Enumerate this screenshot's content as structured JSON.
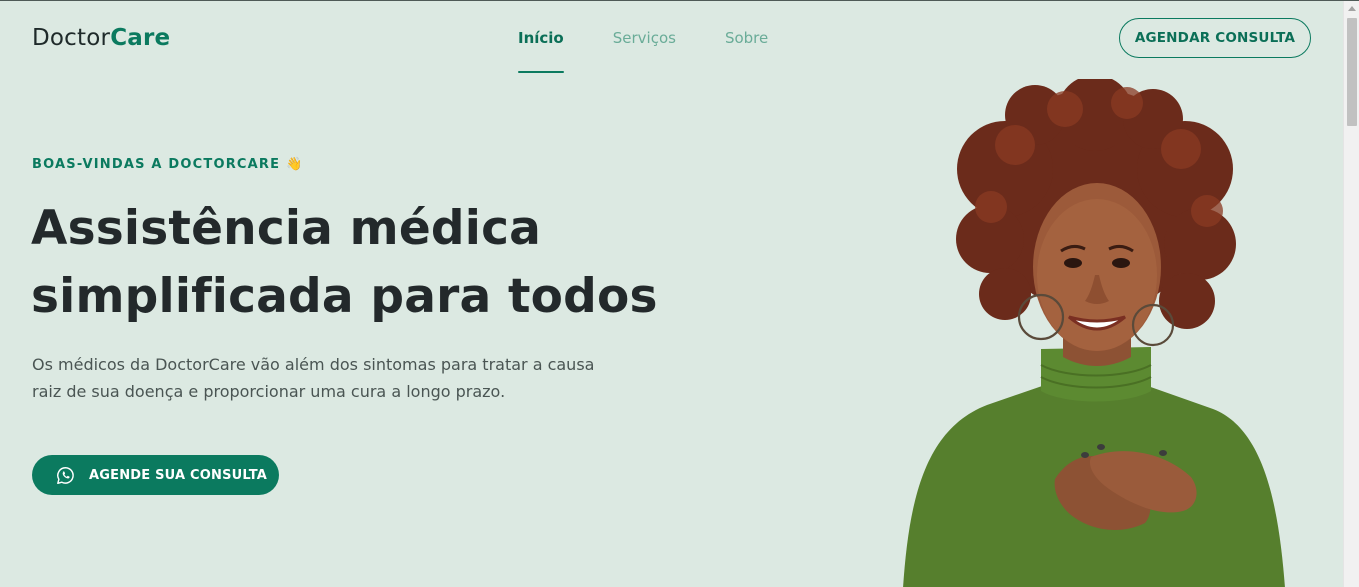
{
  "header": {
    "logo_part1": "Doctor",
    "logo_part2": "Care",
    "nav": [
      {
        "label": "Início",
        "active": true
      },
      {
        "label": "Serviços",
        "active": false
      },
      {
        "label": "Sobre",
        "active": false
      }
    ],
    "cta_label": "AGENDAR CONSULTA"
  },
  "hero": {
    "eyebrow": "BOAS-VINDAS A DOCTORCARE",
    "eyebrow_emoji": "👋",
    "title_line1": "Assistência médica",
    "title_line2": "simplificada para todos",
    "description_line1": "Os médicos da DoctorCare vão além dos sintomas para tratar a causa",
    "description_line2": "raiz de sua doença e proporcionar uma cura a longo prazo.",
    "cta_label": "AGENDE SUA CONSULTA",
    "cta_icon": "whatsapp-icon",
    "image_subject": "smiling woman in green turtleneck with hands on chest"
  },
  "colors": {
    "background": "#dce9e2",
    "brand": "#0b7a5f",
    "text": "#23292b",
    "nav_inactive": "#6aac98"
  }
}
